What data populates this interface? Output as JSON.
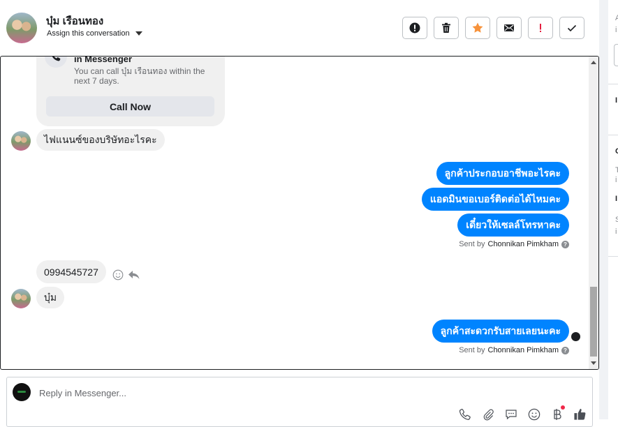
{
  "header": {
    "contact_name": "บุ๋ม เรือนทอง",
    "assign_label": "Assign this conversation",
    "actions": [
      {
        "name": "mark-spam-button",
        "icon": "exclamation-circle-icon"
      },
      {
        "name": "delete-button",
        "icon": "trash-icon"
      },
      {
        "name": "star-button",
        "icon": "star-icon",
        "color": "#f7923b"
      },
      {
        "name": "email-button",
        "icon": "envelope-icon"
      },
      {
        "name": "important-button",
        "icon": "exclamation-icon",
        "color": "#e41e3f"
      },
      {
        "name": "mark-done-button",
        "icon": "check-icon"
      }
    ]
  },
  "call_card": {
    "title": "in Messenger",
    "description": "You can call บุ๋ม เรือนทอง within the next 7 days.",
    "button_label": "Call Now",
    "icon": "phone-icon"
  },
  "messages": [
    {
      "direction": "incoming",
      "text": "ไฟแนนซ์ของบริษัทอะไรคะ"
    },
    {
      "direction": "outgoing",
      "text": "ลูกค้าประกอบอาชีพอะไรคะ"
    },
    {
      "direction": "outgoing",
      "text": "แอดมินขอเบอร์ติดต่อได้ไหมคะ"
    },
    {
      "direction": "outgoing",
      "text": "เดี๋ยวให้เซลล์โทรหาคะ"
    },
    {
      "direction": "incoming",
      "text": "0994545727"
    },
    {
      "direction": "incoming",
      "text": "บุ๋ม"
    },
    {
      "direction": "outgoing",
      "text": "ลูกค้าสะดวกรับสายเลยนะคะ"
    }
  ],
  "sent_by": {
    "prefix": "Sent by",
    "name": "Chonnikan Pimkham",
    "help_glyph": "?"
  },
  "composer": {
    "placeholder": "Reply in Messenger...",
    "tools": [
      "phone-icon",
      "paperclip-icon",
      "chat-bubble-icon",
      "emoji-icon",
      "baht-icon",
      "thumbs-up-icon"
    ]
  },
  "right_panel": {
    "letters": [
      "A",
      "i",
      "I",
      "C",
      "T",
      "i",
      "I",
      "S",
      "i"
    ]
  },
  "colors": {
    "accent": "#0084ff",
    "incoming_bubble": "#f0f0f0",
    "star": "#f7923b",
    "important": "#e41e3f"
  }
}
